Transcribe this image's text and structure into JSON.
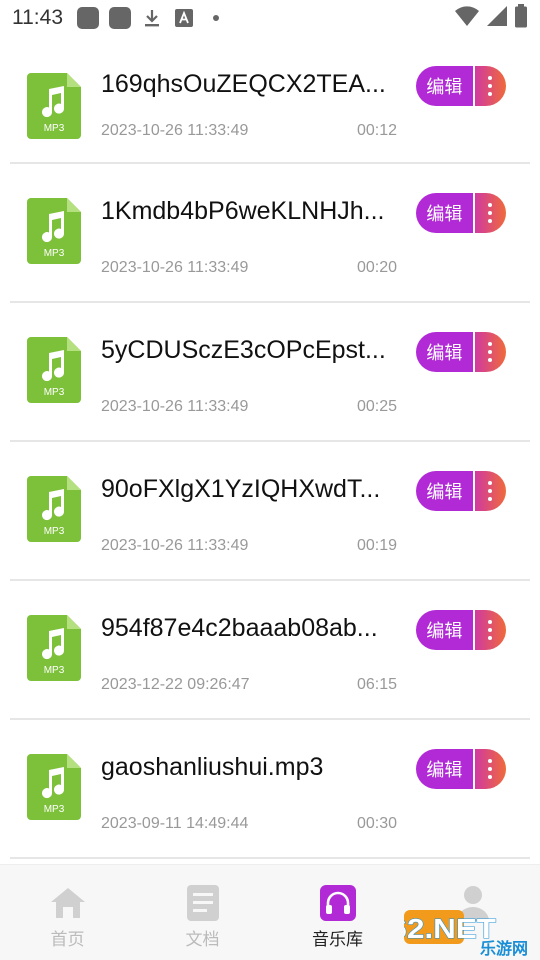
{
  "status_bar": {
    "time": "11:43"
  },
  "files": [
    {
      "name": "169qhsOuZEQCX2TEA...",
      "date": "2023-10-26 11:33:49",
      "duration": "00:12",
      "badge": "MP3"
    },
    {
      "name": "1Kmdb4bP6weKLNHJh...",
      "date": "2023-10-26 11:33:49",
      "duration": "00:20",
      "badge": "MP3"
    },
    {
      "name": "5yCDUSczE3cOPcEpst...",
      "date": "2023-10-26 11:33:49",
      "duration": "00:25",
      "badge": "MP3"
    },
    {
      "name": "90oFXlgX1YzIQHXwdT...",
      "date": "2023-10-26 11:33:49",
      "duration": "00:19",
      "badge": "MP3"
    },
    {
      "name": "954f87e4c2baaab08ab...",
      "date": "2023-12-22 09:26:47",
      "duration": "06:15",
      "badge": "MP3"
    },
    {
      "name": "gaoshanliushui.mp3",
      "date": "2023-09-11 14:49:44",
      "duration": "00:30",
      "badge": "MP3"
    }
  ],
  "actions": {
    "edit_label": "编辑"
  },
  "tabs": [
    {
      "label": "首页",
      "icon": "home-icon"
    },
    {
      "label": "文档",
      "icon": "document-icon"
    },
    {
      "label": "音乐库",
      "icon": "headphones-icon",
      "active": true
    },
    {
      "label": "",
      "icon": "profile-icon"
    }
  ],
  "watermark": {
    "text": "962.NET",
    "sub": "乐游网"
  },
  "colors": {
    "accent": "#b12ad6",
    "file_icon": "#7dc13a",
    "more_gradient_start": "#d03aa0",
    "more_gradient_end": "#ef6a3b"
  }
}
